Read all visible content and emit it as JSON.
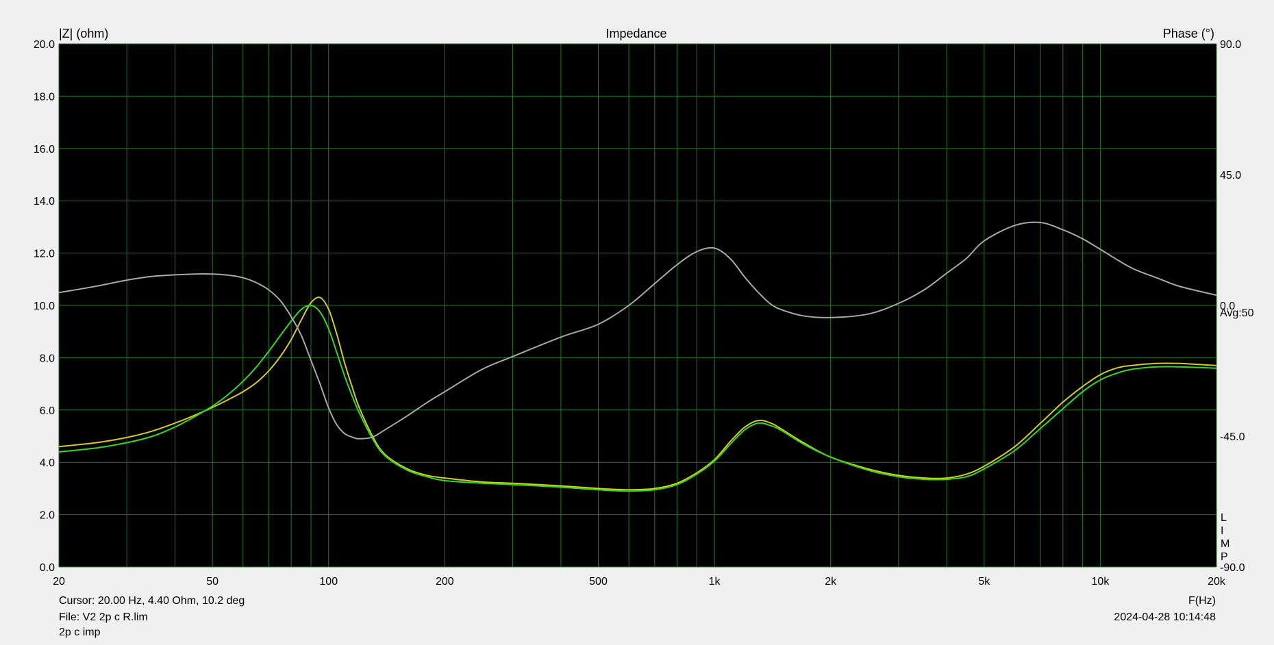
{
  "header": {
    "left_axis_label": "|Z| (ohm)",
    "title": "Impedance",
    "right_axis_label": "Phase (°)"
  },
  "side_labels": {
    "avg": "Avg:50",
    "limp": [
      "L",
      "I",
      "M",
      "P"
    ]
  },
  "footer": {
    "cursor": "Cursor: 20.00 Hz, 4.40 Ohm, 10.2 deg",
    "xunit": "F(Hz)",
    "file": "File: V2 2p c R.lim",
    "datetime": "2024-04-28 10:14:48",
    "note": "2p c imp"
  },
  "colors": {
    "background": "#f0f0f0",
    "plot_bg": "#000000",
    "grid": "#1e7a1e",
    "phase": "#a8a8a8",
    "imp_yellow": "#d6cc1c",
    "imp_green": "#2ddb1e"
  },
  "chart_data": {
    "type": "line",
    "title": "Impedance",
    "xlabel": "F(Hz)",
    "ylabel": "|Z| (ohm)",
    "y2label": "Phase (°)",
    "xscale": "log",
    "xlim": [
      20,
      20000
    ],
    "ylim": [
      0,
      20
    ],
    "y2lim": [
      -90,
      90
    ],
    "grid": true,
    "x_ticks": [
      20,
      50,
      100,
      200,
      500,
      1000,
      2000,
      5000,
      10000,
      20000
    ],
    "x_tick_labels": [
      "20",
      "50",
      "100",
      "200",
      "500",
      "1k",
      "2k",
      "5k",
      "10k",
      "20k"
    ],
    "x_minor_grid": [
      30,
      40,
      60,
      70,
      80,
      90,
      300,
      400,
      600,
      700,
      800,
      900,
      3000,
      4000,
      6000,
      7000,
      8000,
      9000
    ],
    "y_ticks": [
      0,
      2,
      4,
      6,
      8,
      10,
      12,
      14,
      16,
      18,
      20
    ],
    "y_tick_labels": [
      "0.0",
      "2.0",
      "4.0",
      "6.0",
      "8.0",
      "10.0",
      "12.0",
      "14.0",
      "16.0",
      "18.0",
      "20.0"
    ],
    "y2_ticks": [
      90,
      45,
      0,
      -45,
      -90
    ],
    "y2_tick_labels": [
      "90.0",
      "45.0",
      "0.0",
      "-45.0",
      "-90.0"
    ],
    "series": [
      {
        "axis": "left",
        "color": "#d6cc1c",
        "points": [
          [
            20,
            4.6
          ],
          [
            25,
            4.75
          ],
          [
            30,
            4.95
          ],
          [
            35,
            5.2
          ],
          [
            40,
            5.5
          ],
          [
            45,
            5.8
          ],
          [
            50,
            6.1
          ],
          [
            55,
            6.4
          ],
          [
            60,
            6.7
          ],
          [
            65,
            7.05
          ],
          [
            70,
            7.5
          ],
          [
            75,
            8.05
          ],
          [
            80,
            8.7
          ],
          [
            85,
            9.45
          ],
          [
            90,
            10.1
          ],
          [
            95,
            10.3
          ],
          [
            100,
            9.85
          ],
          [
            105,
            8.9
          ],
          [
            110,
            7.8
          ],
          [
            115,
            6.9
          ],
          [
            120,
            6.1
          ],
          [
            130,
            5.0
          ],
          [
            140,
            4.3
          ],
          [
            160,
            3.75
          ],
          [
            180,
            3.5
          ],
          [
            200,
            3.4
          ],
          [
            250,
            3.25
          ],
          [
            300,
            3.2
          ],
          [
            400,
            3.1
          ],
          [
            500,
            3.0
          ],
          [
            600,
            2.95
          ],
          [
            700,
            3.0
          ],
          [
            800,
            3.2
          ],
          [
            900,
            3.6
          ],
          [
            1000,
            4.1
          ],
          [
            1100,
            4.8
          ],
          [
            1200,
            5.35
          ],
          [
            1300,
            5.6
          ],
          [
            1400,
            5.5
          ],
          [
            1500,
            5.25
          ],
          [
            1700,
            4.75
          ],
          [
            2000,
            4.2
          ],
          [
            2500,
            3.75
          ],
          [
            3000,
            3.5
          ],
          [
            3500,
            3.4
          ],
          [
            4000,
            3.4
          ],
          [
            4500,
            3.55
          ],
          [
            5000,
            3.85
          ],
          [
            6000,
            4.6
          ],
          [
            7000,
            5.5
          ],
          [
            8000,
            6.3
          ],
          [
            9000,
            6.9
          ],
          [
            10000,
            7.35
          ],
          [
            11000,
            7.6
          ],
          [
            12000,
            7.7
          ],
          [
            14000,
            7.78
          ],
          [
            16000,
            7.78
          ],
          [
            20000,
            7.7
          ]
        ]
      },
      {
        "axis": "left",
        "color": "#2ddb1e",
        "points": [
          [
            20,
            4.4
          ],
          [
            25,
            4.55
          ],
          [
            30,
            4.75
          ],
          [
            35,
            5.0
          ],
          [
            40,
            5.35
          ],
          [
            45,
            5.75
          ],
          [
            50,
            6.15
          ],
          [
            55,
            6.6
          ],
          [
            60,
            7.1
          ],
          [
            65,
            7.65
          ],
          [
            70,
            8.25
          ],
          [
            75,
            8.85
          ],
          [
            80,
            9.4
          ],
          [
            85,
            9.85
          ],
          [
            90,
            10.0
          ],
          [
            95,
            9.75
          ],
          [
            100,
            9.1
          ],
          [
            105,
            8.2
          ],
          [
            110,
            7.3
          ],
          [
            115,
            6.55
          ],
          [
            120,
            5.9
          ],
          [
            130,
            4.9
          ],
          [
            140,
            4.25
          ],
          [
            160,
            3.7
          ],
          [
            180,
            3.45
          ],
          [
            200,
            3.3
          ],
          [
            250,
            3.2
          ],
          [
            300,
            3.15
          ],
          [
            400,
            3.05
          ],
          [
            500,
            2.95
          ],
          [
            600,
            2.9
          ],
          [
            700,
            2.95
          ],
          [
            800,
            3.15
          ],
          [
            900,
            3.55
          ],
          [
            1000,
            4.05
          ],
          [
            1100,
            4.7
          ],
          [
            1200,
            5.25
          ],
          [
            1300,
            5.5
          ],
          [
            1400,
            5.4
          ],
          [
            1500,
            5.2
          ],
          [
            1700,
            4.7
          ],
          [
            2000,
            4.2
          ],
          [
            2500,
            3.7
          ],
          [
            3000,
            3.45
          ],
          [
            3500,
            3.35
          ],
          [
            4000,
            3.35
          ],
          [
            4500,
            3.45
          ],
          [
            5000,
            3.75
          ],
          [
            6000,
            4.45
          ],
          [
            7000,
            5.3
          ],
          [
            8000,
            6.05
          ],
          [
            9000,
            6.7
          ],
          [
            10000,
            7.15
          ],
          [
            11000,
            7.4
          ],
          [
            12000,
            7.55
          ],
          [
            14000,
            7.65
          ],
          [
            16000,
            7.65
          ],
          [
            20000,
            7.6
          ]
        ]
      },
      {
        "axis": "right",
        "color": "#a8a8a8",
        "points": [
          [
            20,
            4.4
          ],
          [
            25,
            6.6
          ],
          [
            30,
            8.7
          ],
          [
            35,
            10.0
          ],
          [
            40,
            10.5
          ],
          [
            45,
            10.8
          ],
          [
            50,
            10.8
          ],
          [
            55,
            10.4
          ],
          [
            60,
            9.5
          ],
          [
            65,
            7.8
          ],
          [
            70,
            5.3
          ],
          [
            75,
            1.6
          ],
          [
            80,
            -3.9
          ],
          [
            85,
            -10.4
          ],
          [
            90,
            -18.9
          ],
          [
            95,
            -27.0
          ],
          [
            100,
            -35.3
          ],
          [
            105,
            -41.1
          ],
          [
            110,
            -44.1
          ],
          [
            115,
            -45.3
          ],
          [
            120,
            -45.9
          ],
          [
            130,
            -45.3
          ],
          [
            140,
            -42.8
          ],
          [
            160,
            -38.0
          ],
          [
            180,
            -33.4
          ],
          [
            200,
            -29.7
          ],
          [
            250,
            -22.0
          ],
          [
            300,
            -17.6
          ],
          [
            400,
            -10.9
          ],
          [
            500,
            -6.5
          ],
          [
            600,
            0.0
          ],
          [
            700,
            7.5
          ],
          [
            800,
            14.0
          ],
          [
            900,
            18.5
          ],
          [
            1000,
            19.7
          ],
          [
            1100,
            16.0
          ],
          [
            1200,
            9.6
          ],
          [
            1300,
            4.4
          ],
          [
            1400,
            0.4
          ],
          [
            1500,
            -1.6
          ],
          [
            1700,
            -3.6
          ],
          [
            2000,
            -4.2
          ],
          [
            2500,
            -3.0
          ],
          [
            3000,
            0.7
          ],
          [
            3500,
            5.4
          ],
          [
            4000,
            11.1
          ],
          [
            4500,
            16.2
          ],
          [
            5000,
            22.2
          ],
          [
            6000,
            27.5
          ],
          [
            7000,
            28.5
          ],
          [
            8000,
            26.0
          ],
          [
            9000,
            22.9
          ],
          [
            10000,
            19.3
          ],
          [
            12000,
            13.0
          ],
          [
            14000,
            9.5
          ],
          [
            16000,
            6.6
          ],
          [
            20000,
            3.5
          ]
        ]
      }
    ]
  }
}
